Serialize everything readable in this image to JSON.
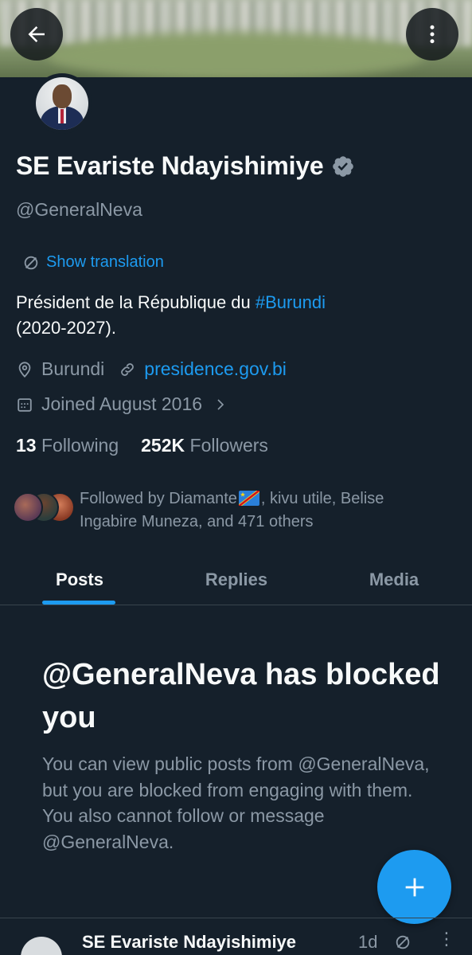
{
  "profile": {
    "name": "SE Evariste Ndayishimiye",
    "handle": "@GeneralNeva",
    "bio_before": "Président de la République du ",
    "bio_hashtag": "#Burundi",
    "bio_after": " (2020-2027).",
    "location": "Burundi",
    "website": "presidence.gov.bi",
    "joined": "Joined August 2016"
  },
  "translation": {
    "label": "Show translation"
  },
  "stats": {
    "following_count": "13",
    "following_label": "Following",
    "followers_count": "252K",
    "followers_label": "Followers"
  },
  "followed_by": {
    "part1": "Followed by Diamante",
    "part2": ", kivu utile, Belise Ingabire Muneza, and 471 others"
  },
  "tabs": [
    {
      "label": "Posts",
      "active": true
    },
    {
      "label": "Replies",
      "active": false
    },
    {
      "label": "Media",
      "active": false
    }
  ],
  "blocked": {
    "title": "@GeneralNeva has blocked you",
    "description": "You can view public posts from @GeneralNeva, but you are blocked from engaging with them. You also cannot follow or message @GeneralNeva."
  },
  "bottom_post": {
    "name": "SE Evariste Ndayishimiye",
    "time": "1d"
  },
  "colors": {
    "background": "#15202b",
    "accent": "#1d9bf0",
    "secondary_text": "#8b98a5",
    "verified_badge": "#8b98a5"
  }
}
